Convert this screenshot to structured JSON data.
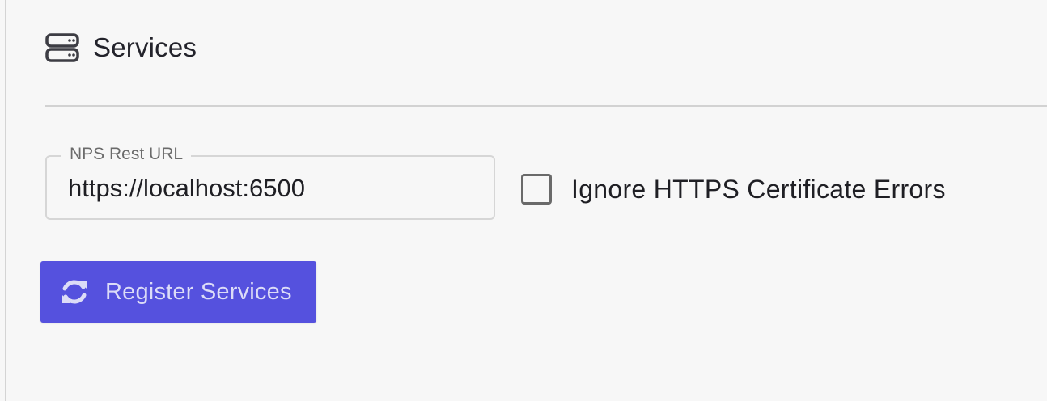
{
  "section": {
    "title": "Services",
    "icon": "server-stack-icon"
  },
  "form": {
    "url_field": {
      "label": "NPS Rest URL",
      "value": "https://localhost:6500"
    },
    "ignore_https": {
      "label": "Ignore HTTPS Certificate Errors",
      "checked": false
    },
    "register_button": {
      "label": "Register Services",
      "icon": "refresh-icon"
    }
  },
  "colors": {
    "accent": "#5551de",
    "background": "#f7f7f7",
    "text": "#1f1f24"
  }
}
